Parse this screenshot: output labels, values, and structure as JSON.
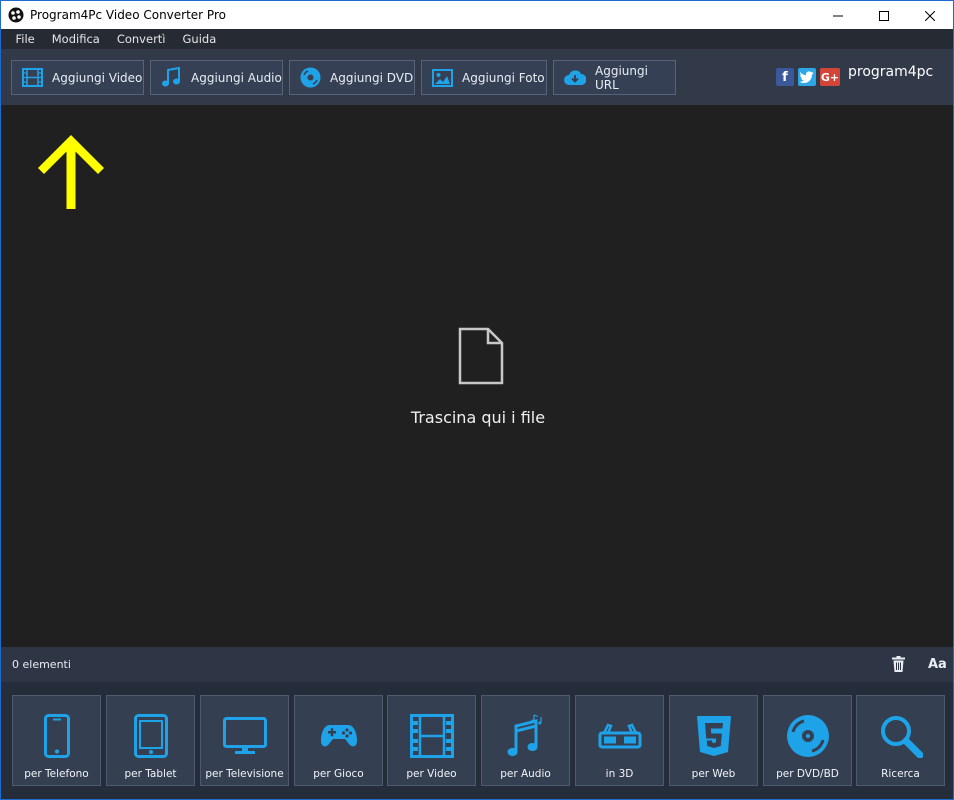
{
  "window": {
    "title": "Program4Pc Video Converter Pro"
  },
  "menu": [
    "File",
    "Modifica",
    "Convertì",
    "Guida"
  ],
  "toolbar": {
    "buttons": [
      {
        "label": "Aggiungi Video",
        "icon": "film-icon"
      },
      {
        "label": "Aggiungi Audio",
        "icon": "music-note-icon"
      },
      {
        "label": "Aggiungi DVD",
        "icon": "disc-icon"
      },
      {
        "label": "Aggiungi Foto",
        "icon": "image-icon"
      },
      {
        "label": "Aggiungi URL",
        "icon": "cloud-download-icon"
      }
    ],
    "social": [
      "facebook-icon",
      "twitter-icon",
      "google-plus-icon"
    ],
    "brand": "program4pc"
  },
  "main": {
    "drop_text": "Trascina qui i file"
  },
  "status": {
    "count_label": "0  elementi",
    "font_button": "Aa"
  },
  "categories": [
    {
      "label": "per Telefono",
      "icon": "phone-icon"
    },
    {
      "label": "per Tablet",
      "icon": "tablet-icon"
    },
    {
      "label": "per Televisione",
      "icon": "tv-icon"
    },
    {
      "label": "per Gioco",
      "icon": "gamepad-icon"
    },
    {
      "label": "per Video",
      "icon": "film-icon"
    },
    {
      "label": "per Audio",
      "icon": "music-notes-icon"
    },
    {
      "label": "in 3D",
      "icon": "3d-glasses-icon"
    },
    {
      "label": "per Web",
      "icon": "html5-icon"
    },
    {
      "label": "per DVD/BD",
      "icon": "disc-icon"
    },
    {
      "label": "Ricerca",
      "icon": "search-icon"
    }
  ],
  "colors": {
    "accent": "#1fa3e8",
    "toolbar_bg": "#323a4a",
    "drop_bg": "#202020",
    "arrow": "#ffff00"
  }
}
